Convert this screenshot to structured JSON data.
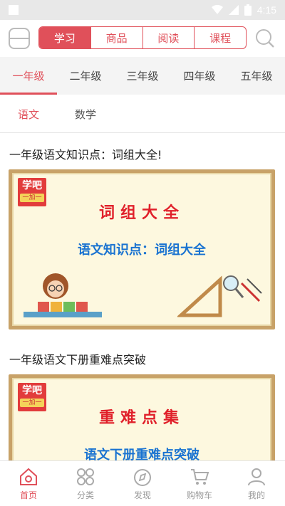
{
  "status_bar": {
    "time": "4:15"
  },
  "header": {
    "segments": [
      "学习",
      "商品",
      "阅读",
      "课程"
    ],
    "active_segment": 0
  },
  "grade_tabs": [
    "一年级",
    "二年级",
    "三年级",
    "四年级",
    "五年级"
  ],
  "subject_tabs": [
    "语文",
    "数学"
  ],
  "articles": [
    {
      "title": "一年级语文知识点：词组大全!",
      "banner_logo": "学吧",
      "banner_logo_sub": "一加一",
      "banner_heading": "词组大全",
      "banner_sub": "语文知识点：词组大全"
    },
    {
      "title": "一年级语文下册重难点突破",
      "banner_logo": "学吧",
      "banner_logo_sub": "一加一",
      "banner_heading": "重难点集",
      "banner_sub": "语文下册重难点突破"
    }
  ],
  "bottom_nav": [
    {
      "label": "首页",
      "icon": "home-icon"
    },
    {
      "label": "分类",
      "icon": "category-icon"
    },
    {
      "label": "发现",
      "icon": "discover-icon"
    },
    {
      "label": "购物车",
      "icon": "cart-icon"
    },
    {
      "label": "我的",
      "icon": "profile-icon"
    }
  ],
  "colors": {
    "accent": "#e0505a",
    "banner_red": "#e0202a",
    "banner_blue": "#1a73d1"
  }
}
